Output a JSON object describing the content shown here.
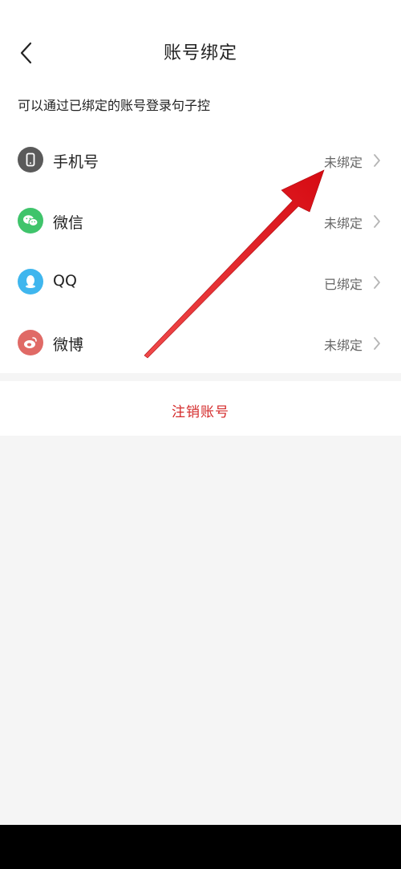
{
  "header": {
    "title": "账号绑定"
  },
  "hint": "可以通过已绑定的账号登录句子控",
  "accounts": [
    {
      "label": "手机号",
      "status": "未绑定",
      "icon": "phone-icon",
      "color": "#5a5a5a"
    },
    {
      "label": "微信",
      "status": "未绑定",
      "icon": "wechat-icon",
      "color": "#3fc46b"
    },
    {
      "label": "QQ",
      "status": "已绑定",
      "icon": "qq-icon",
      "color": "#3fb6ee"
    },
    {
      "label": "微博",
      "status": "未绑定",
      "icon": "weibo-icon",
      "color": "#e06a66"
    }
  ],
  "cancel_label": "注销账号",
  "colors": {
    "danger": "#d42a2a",
    "background": "#f5f5f5",
    "annotation_arrow": "#e8141c"
  }
}
